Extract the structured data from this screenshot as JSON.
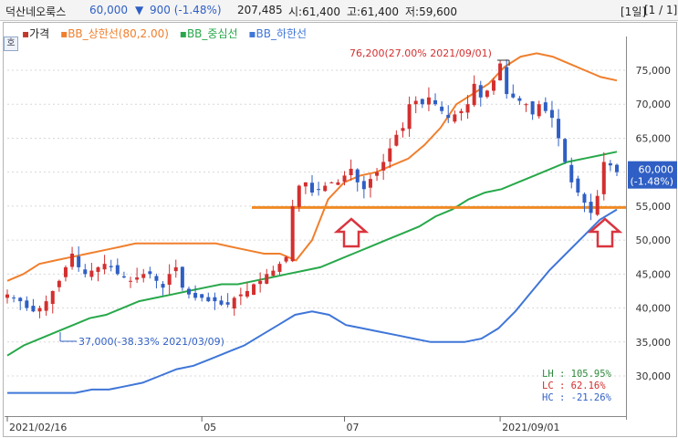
{
  "header": {
    "name": "덕산네오룩스",
    "price": "60,000",
    "change_arrow": "▼",
    "change": "900 (-1.48%)",
    "volume": "207,485",
    "open": "시:61,400",
    "high": "고:61,400",
    "low": "저:59,600",
    "period_label": "[1일]",
    "page_label": "[1 / 1]"
  },
  "corner_tag": "호",
  "legend": [
    {
      "label": "가격",
      "color": "#c0392b"
    },
    {
      "label": "BB_상한선(80,2.00)",
      "color": "#f07f2d"
    },
    {
      "label": "BB_중심선",
      "color": "#27a84a"
    },
    {
      "label": "BB_하한선",
      "color": "#3f76d8"
    }
  ],
  "price_badge": {
    "price": "60,000",
    "change": "(-1.48%)"
  },
  "annotations": {
    "high": "76,200(27.00% 2021/09/01)",
    "low": "37,000(-38.33% 2021/03/09)"
  },
  "stats": [
    {
      "label": "LH",
      "value": "105.95%",
      "color": "#2e8b3d"
    },
    {
      "label": "LC",
      "value": "62.16%",
      "color": "#d22c2c"
    },
    {
      "label": "HC",
      "value": "-21.26%",
      "color": "#2f5fc4"
    }
  ],
  "chart_data": {
    "type": "candlestick",
    "y_ticks": [
      75000,
      70000,
      65000,
      60000,
      55000,
      50000,
      45000,
      40000,
      35000,
      30000
    ],
    "y_tick_labels": [
      "75,000",
      "70,000",
      "65,000",
      "60,000",
      "55,000",
      "50,000",
      "45,000",
      "40,000",
      "35,000",
      "30,000"
    ],
    "ylim": [
      25000,
      80000
    ],
    "x_tick_labels": [
      {
        "label": "2021/02/16",
        "day": 0
      },
      {
        "label": "05",
        "day": 30
      },
      {
        "label": "07",
        "day": 52
      },
      {
        "label": "2021/09/01",
        "day": 76
      }
    ],
    "support_level": 54800,
    "close_series_approx": [
      42000,
      41500,
      41000,
      40000,
      39500,
      40000,
      41000,
      42500,
      44000,
      46000,
      48000,
      46000,
      45000,
      45500,
      46000,
      46500,
      46000,
      45000,
      44500,
      44000,
      44500,
      45000,
      45000,
      44000,
      43000,
      45000,
      46000,
      43000,
      42000,
      41500,
      41500,
      41000,
      41000,
      40500,
      40500,
      41500,
      42000,
      42500,
      43500,
      44000,
      45000,
      45500,
      46500,
      47500,
      55000,
      58000,
      58500,
      57000,
      57500,
      58000,
      58500,
      58500,
      59500,
      60500,
      58500,
      57500,
      59000,
      60000,
      61500,
      63500,
      65500,
      66500,
      70000,
      70500,
      70000,
      71000,
      70000,
      69000,
      68000,
      68500,
      69000,
      70000,
      73000,
      71000,
      72000,
      73500,
      76000,
      71500,
      71000,
      70500,
      70000,
      68500,
      70000,
      69000,
      68000,
      65000,
      61500,
      58500,
      57000,
      55500,
      54000,
      56500,
      61500,
      61000,
      60000
    ],
    "bb_upper_approx": [
      44000,
      45000,
      46500,
      47000,
      47500,
      48000,
      48500,
      49000,
      49500,
      49500,
      49500,
      49500,
      49500,
      49500,
      49000,
      48500,
      48000,
      48000,
      47000,
      50000,
      56000,
      58500,
      59500,
      60000,
      61000,
      62000,
      64000,
      66500,
      70000,
      71500,
      73000,
      75500,
      77000,
      77500,
      77000,
      76000,
      75000,
      74000,
      73500
    ],
    "bb_middle_approx": [
      33000,
      34500,
      35500,
      36500,
      37500,
      38500,
      39000,
      40000,
      41000,
      41500,
      42000,
      42500,
      43000,
      43500,
      43500,
      44000,
      44500,
      45000,
      45500,
      46000,
      47000,
      48000,
      49000,
      50000,
      51000,
      52000,
      53500,
      54500,
      56000,
      57000,
      57500,
      58500,
      59500,
      60500,
      61500,
      62000,
      62500,
      63000
    ],
    "bb_lower_approx": [
      27500,
      27500,
      27500,
      27500,
      27500,
      28000,
      28000,
      28500,
      29000,
      30000,
      31000,
      31500,
      32500,
      33500,
      34500,
      36000,
      37500,
      39000,
      39500,
      39000,
      37500,
      37000,
      36500,
      36000,
      35500,
      35000,
      35000,
      35000,
      35500,
      37000,
      39500,
      42500,
      45500,
      48000,
      50500,
      53000,
      54500
    ]
  }
}
